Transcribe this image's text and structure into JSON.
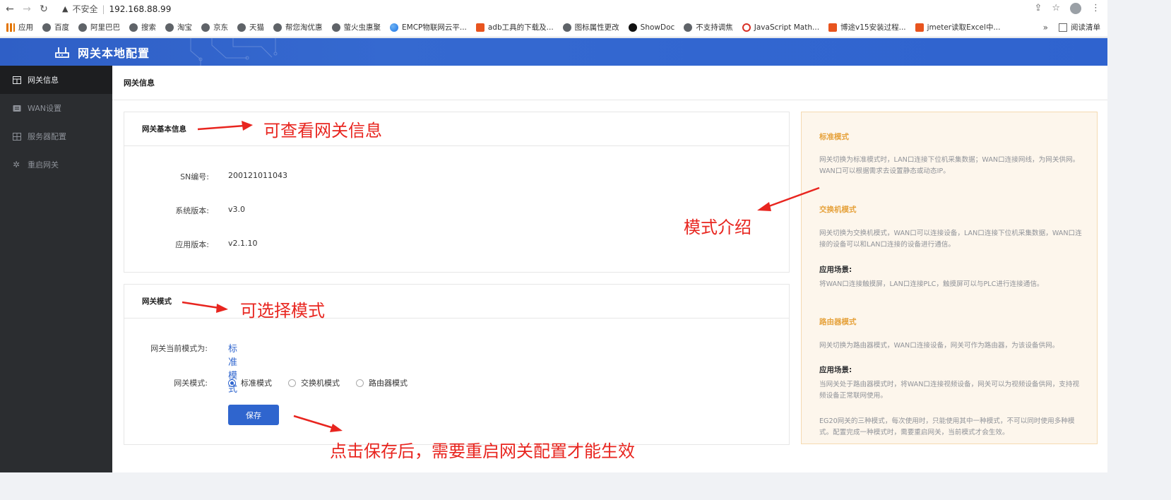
{
  "browser": {
    "insecure_label": "不安全",
    "url": "192.168.88.99",
    "bookmarks": [
      {
        "label": "应用",
        "icon": "apps-grid-icon"
      },
      {
        "label": "百度",
        "icon": "globe-icon"
      },
      {
        "label": "阿里巴巴",
        "icon": "globe-icon"
      },
      {
        "label": "搜索",
        "icon": "globe-icon"
      },
      {
        "label": "淘宝",
        "icon": "globe-icon"
      },
      {
        "label": "京东",
        "icon": "globe-icon"
      },
      {
        "label": "天猫",
        "icon": "globe-icon"
      },
      {
        "label": "帮您淘优惠",
        "icon": "globe-icon"
      },
      {
        "label": "萤火虫惠聚",
        "icon": "globe-icon"
      },
      {
        "label": "EMCP物联网云平...",
        "icon": "emcp-icon"
      },
      {
        "label": "adb工具的下载及...",
        "icon": "csdn-icon"
      },
      {
        "label": "图标属性更改",
        "icon": "globe-icon"
      },
      {
        "label": "ShowDoc",
        "icon": "showdoc-icon"
      },
      {
        "label": "不支持调焦",
        "icon": "globe-icon"
      },
      {
        "label": "JavaScript Math...",
        "icon": "js-icon"
      },
      {
        "label": "博途v15安装过程...",
        "icon": "csdn-icon"
      },
      {
        "label": "jmeter读取Excel中...",
        "icon": "csdn-icon"
      }
    ],
    "more_label": "»",
    "reading_list_label": "阅读清单"
  },
  "app": {
    "title": "网关本地配置"
  },
  "sidebar": {
    "items": [
      {
        "label": "网关信息",
        "icon": "table-icon",
        "active": true
      },
      {
        "label": "WAN设置",
        "icon": "router-icon",
        "active": false
      },
      {
        "label": "服务器配置",
        "icon": "server-icon",
        "active": false
      },
      {
        "label": "重启网关",
        "icon": "gear-icon",
        "active": false
      }
    ]
  },
  "breadcrumb": "网关信息",
  "basic_info": {
    "title": "网关基本信息",
    "rows": [
      {
        "label": "SN编号:",
        "value": "200121011043"
      },
      {
        "label": "系统版本:",
        "value": "v3.0"
      },
      {
        "label": "应用版本:",
        "value": "v2.1.10"
      }
    ]
  },
  "gateway_mode": {
    "title": "网关模式",
    "current_label": "网关当前模式为:",
    "current_value": "标准模式",
    "mode_label": "网关模式:",
    "options": [
      {
        "label": "标准模式",
        "selected": true
      },
      {
        "label": "交换机模式",
        "selected": false
      },
      {
        "label": "路由器模式",
        "selected": false
      }
    ],
    "save_label": "保存"
  },
  "mode_intro": {
    "standard": {
      "title": "标准模式",
      "text": "网关切换为标准模式时，LAN口连接下位机采集数据；WAN口连接网线，为网关供网。WAN口可以根据需求去设置静态或动态IP。"
    },
    "switch": {
      "title": "交换机模式",
      "text": "网关切换为交换机模式，WAN口可以连接设备，LAN口连接下位机采集数据，WAN口连接的设备可以和LAN口连接的设备进行通信。",
      "scene_label": "应用场景:",
      "scene_text": "将WAN口连接触摸屏，LAN口连接PLC，触摸屏可以与PLC进行连接通信。"
    },
    "router": {
      "title": "路由器模式",
      "text": "网关切换为路由器模式，WAN口连接设备，网关可作为路由器，为该设备供网。",
      "scene_label": "应用场景:",
      "scene_text": "当网关处于路由器模式时，将WAN口连接视频设备，网关可以为视频设备供网，支持视频设备正常联网使用。",
      "note": "EG20网关的三种模式，每次使用时，只能使用其中一种模式，不可以同时使用多种模式。配置完成一种模式时，需要重启网关，当前模式才会生效。"
    }
  },
  "annotations": {
    "view_info": "可查看网关信息",
    "select_mode": "可选择模式",
    "mode_intro": "模式介绍",
    "save_hint": "点击保存后，需要重启网关配置才能生效"
  },
  "colors": {
    "header_blue": "#2f62cc",
    "sidebar_bg": "#2b2d30",
    "accent": "#2f65ce",
    "panel_title": "#e6a23c",
    "annotation": "#e8251f"
  }
}
